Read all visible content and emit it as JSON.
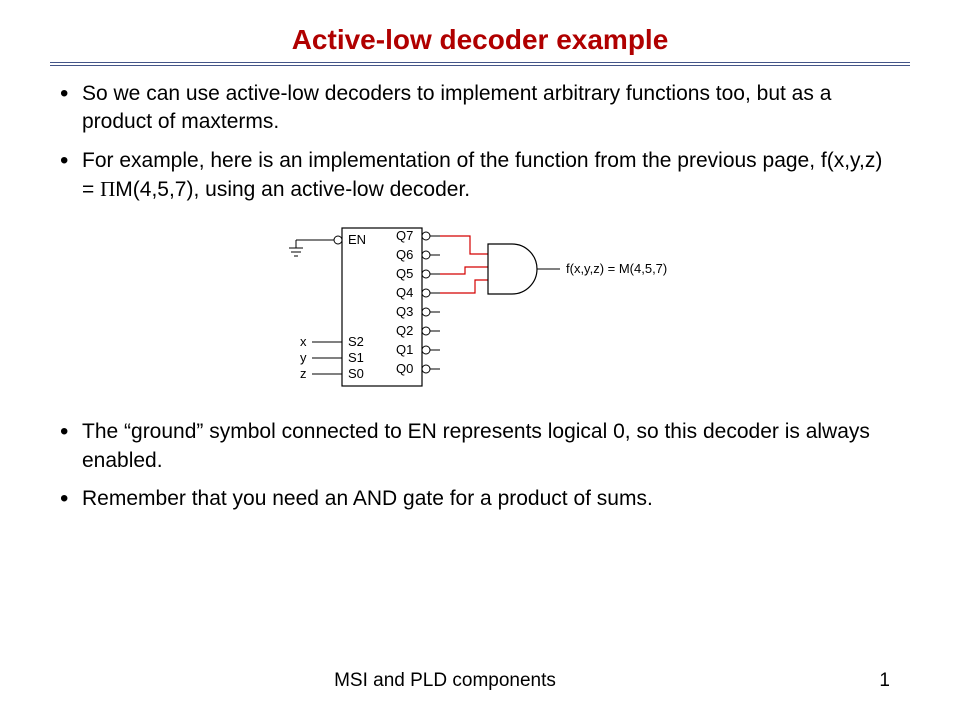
{
  "title": "Active-low decoder example",
  "bullets": {
    "b1": "So we can use active-low decoders to implement arbitrary functions too, but as a product of maxterms.",
    "b2_pre": "For example, here is an implementation of the function from the previous page, f(x,y,z) = ",
    "b2_pi": "Π",
    "b2_post": "M(4,5,7), using an active-low decoder.",
    "b3": "The “ground” symbol connected to EN represents logical 0, so this decoder is always enabled.",
    "b4": "Remember that you need an AND gate for a product of sums."
  },
  "diagram": {
    "en_label": "EN",
    "inputs": {
      "x": "x",
      "y": "y",
      "z": "z"
    },
    "selects": {
      "s2": "S2",
      "s1": "S1",
      "s0": "S0"
    },
    "outputs": {
      "q7": "Q7",
      "q6": "Q6",
      "q5": "Q5",
      "q4": "Q4",
      "q3": "Q3",
      "q2": "Q2",
      "q1": "Q1",
      "q0": "Q0"
    },
    "fn_label": "f(x,y,z) = M(4,5,7)",
    "connected_outputs": [
      "q7",
      "q5",
      "q4"
    ]
  },
  "footer": "MSI and PLD components",
  "page": "1"
}
